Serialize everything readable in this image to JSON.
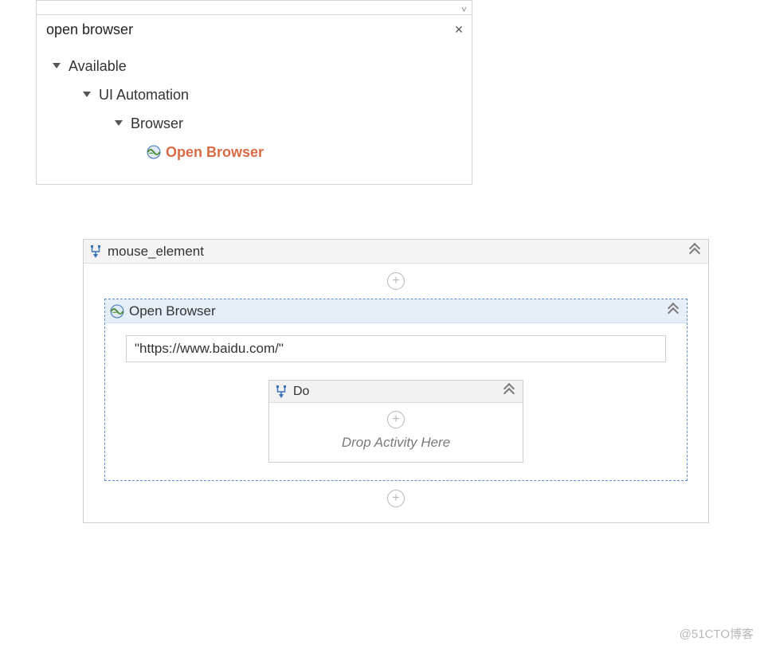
{
  "search": {
    "value": "open browser",
    "clear_icon": "×"
  },
  "tree": {
    "root": "Available",
    "category": "UI Automation",
    "subcategory": "Browser",
    "leaf": "Open Browser"
  },
  "designer": {
    "sequence_name": "mouse_element",
    "open_browser": {
      "title": "Open Browser",
      "url": "\"https://www.baidu.com/\"",
      "do_title": "Do",
      "drop_hint": "Drop Activity Here"
    }
  },
  "icons": {
    "globe": "globe-icon",
    "sequence": "sequence-icon",
    "plus": "+",
    "chevron_up": "chevron-double-up",
    "clear": "close-icon",
    "dropdown": "˅"
  },
  "watermark": "@51CTO博客"
}
